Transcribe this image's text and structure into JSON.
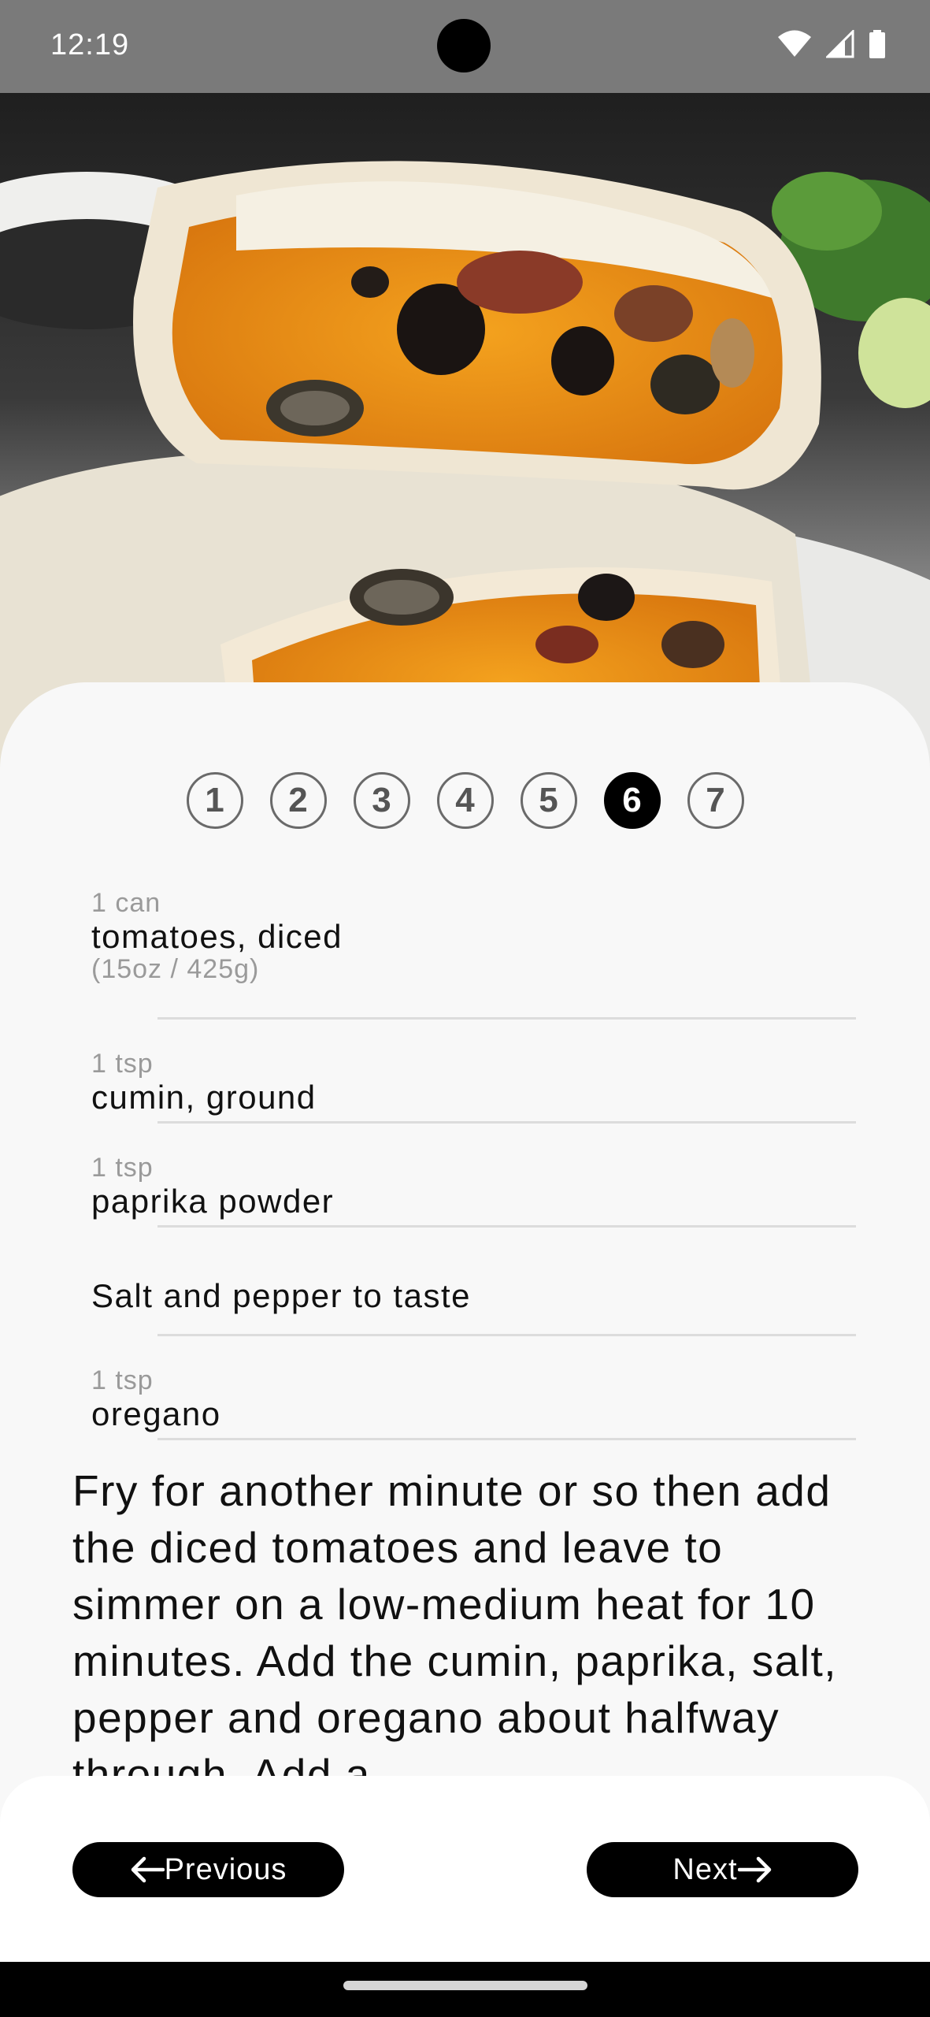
{
  "status_bar": {
    "time": "12:19",
    "icons": [
      "wifi-icon",
      "cell-signal-icon",
      "battery-icon"
    ]
  },
  "hero": {
    "image": "burrito-photo"
  },
  "steps": {
    "items": [
      "1",
      "2",
      "3",
      "4",
      "5",
      "6",
      "7"
    ],
    "active": "6"
  },
  "ingredients": [
    {
      "qty": "1 can",
      "name": "tomatoes, diced",
      "note": "(15oz / 425g)"
    },
    {
      "qty": "1 tsp",
      "name": "cumin, ground",
      "note": ""
    },
    {
      "qty": "1 tsp",
      "name": "paprika powder",
      "note": ""
    },
    {
      "qty": "",
      "name": "Salt and pepper to taste",
      "note": ""
    },
    {
      "qty": "1 tsp",
      "name": "oregano",
      "note": ""
    }
  ],
  "instructions": {
    "text": "Fry for another minute or so then add the diced tomatoes and leave to simmer on a low-medium heat for 10 minutes. Add the cumin, paprika, salt, pepper and oregano about halfway through. Add a"
  },
  "navigation": {
    "previous_label": "Previous",
    "next_label": "Next"
  },
  "colors": {
    "status_bar": "#7a7a7a",
    "sheet_background": "#f8f8f8",
    "button": "#000000",
    "button_text": "#ffffff"
  }
}
